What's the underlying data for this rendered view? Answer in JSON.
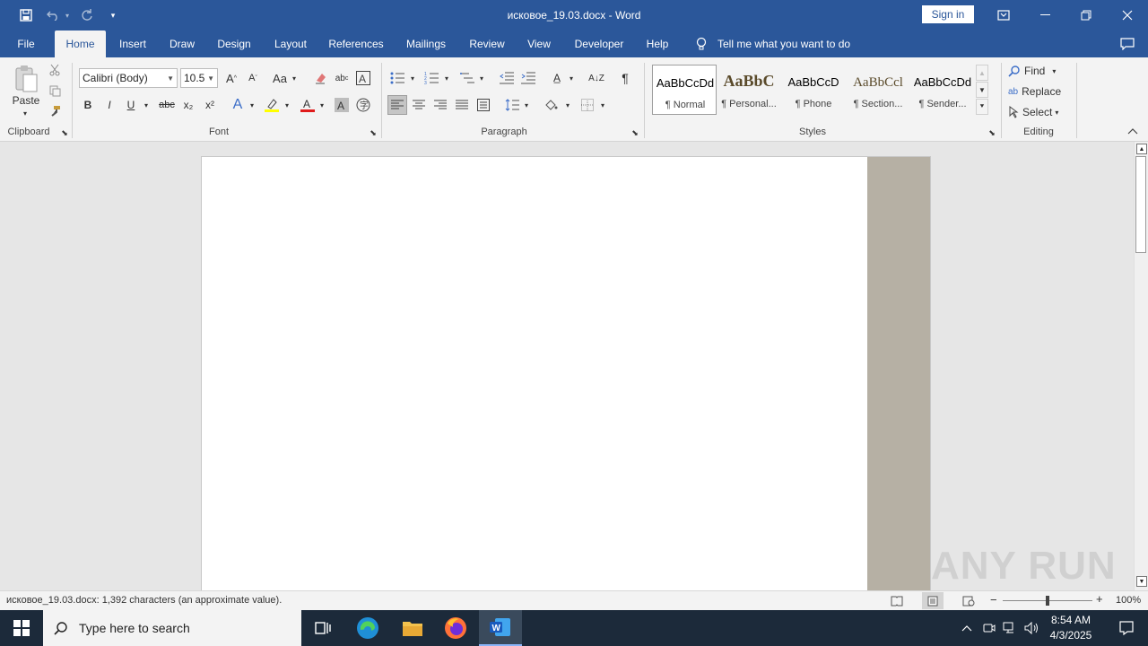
{
  "titlebar": {
    "document_title": "исковое_19.03.docx  -  Word",
    "sign_in_label": "Sign in",
    "save_icon": "save-icon",
    "undo_icon": "undo-icon",
    "redo_icon": "redo-icon",
    "customize_icon": "customize-quick-access-icon",
    "ribbon_display_icon": "ribbon-display-options-icon",
    "minimize_icon": "minimize-icon",
    "restore_icon": "restore-icon",
    "close_icon": "close-icon"
  },
  "tabs": [
    {
      "label": "File"
    },
    {
      "label": "Home"
    },
    {
      "label": "Insert"
    },
    {
      "label": "Draw"
    },
    {
      "label": "Design"
    },
    {
      "label": "Layout"
    },
    {
      "label": "References"
    },
    {
      "label": "Mailings"
    },
    {
      "label": "Review"
    },
    {
      "label": "View"
    },
    {
      "label": "Developer"
    },
    {
      "label": "Help"
    }
  ],
  "tell_me": "Tell me what you want to do",
  "ribbon": {
    "clipboard": {
      "label": "Clipboard",
      "paste_label": "Paste"
    },
    "font": {
      "label": "Font",
      "font_name": "Calibri (Body)",
      "font_size": "10.5",
      "change_case": "Aa",
      "bold": "B",
      "italic": "I",
      "underline": "U",
      "strikethrough": "abc",
      "subscript": "x₂",
      "superscript": "x²"
    },
    "paragraph": {
      "label": "Paragraph"
    },
    "styles": {
      "label": "Styles",
      "items": [
        {
          "sample": "AaBbCcDd",
          "name": "¶ Normal"
        },
        {
          "sample": "AaBbC",
          "name": "¶ Personal..."
        },
        {
          "sample": "AaBbCcD",
          "name": "¶ Phone"
        },
        {
          "sample": "AaBbCcl",
          "name": "¶ Section..."
        },
        {
          "sample": "AaBbCcDd",
          "name": "¶ Sender..."
        }
      ]
    },
    "editing": {
      "label": "Editing",
      "find": "Find",
      "replace": "Replace",
      "select": "Select"
    }
  },
  "statusbar": {
    "text": "исковое_19.03.docx: 1,392 characters (an approximate value).",
    "zoom_label": "100%",
    "zoom_percent": 100
  },
  "taskbar": {
    "search_placeholder": "Type here to search",
    "time": "8:54 AM",
    "date": "4/3/2025"
  },
  "watermark": "ANY RUN",
  "colors": {
    "word_blue": "#2b579a",
    "ribbon_bg": "#f3f3f3",
    "taskbar_bg": "#1c2a3a"
  }
}
